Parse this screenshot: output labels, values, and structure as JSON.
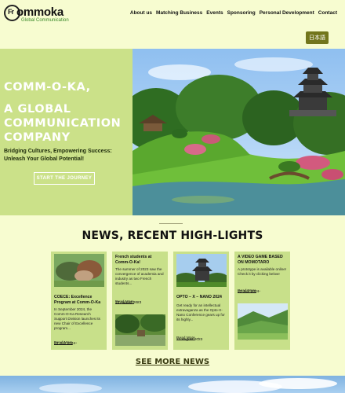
{
  "brand": {
    "logo_mark": "Fr",
    "name": "ommoka",
    "tagline": "Global Communication"
  },
  "nav": {
    "items": [
      {
        "label": "About us"
      },
      {
        "label": "Matching Business"
      },
      {
        "label": "Events"
      },
      {
        "label": "Sponsoring"
      },
      {
        "label": "Personal Development"
      },
      {
        "label": "Contact"
      }
    ]
  },
  "lang_button": "日本語",
  "hero": {
    "title_line1": "COMM-O-KA,",
    "title_line2": "A GLOBAL COMMUNICATION COMPANY",
    "subtitle": "Bridging Cultures, Empowering Success: Unleash Your Global Potential!",
    "cta": "START THE JOURNEY"
  },
  "news": {
    "heading": "NEWS, RECENT HIGH-LIGHTS",
    "cards": [
      {
        "title": "COECE: Excellence Program at Comm-O-Ka",
        "text": "In September 2024, the Comm-O-Ka Research Support Division launches its new Chair of Excellence program...",
        "read_more": "Read More",
        "date": "23 July 2024"
      },
      {
        "title": "French students at Comm-O-Ka!",
        "text": "The summer of 2023 saw the convergence of academia and industry as two French students...",
        "read_more": "Read More",
        "date": "13 August 2023"
      },
      {
        "title": "OPTO – X – NANO 2024",
        "text": "Get ready for an intellectual extravaganza as the Opto-X-Nano Conference gears up for its highly...",
        "read_more": "Read More",
        "date": "12 August 2023"
      },
      {
        "title": "A VIDEO GAME BASED ON MOMOTARO",
        "text": "A prototype is available online! Check it by clicking below!",
        "read_more": "Read More",
        "date": "23 July 2024"
      }
    ],
    "see_more": "SEE MORE NEWS"
  },
  "colors": {
    "page_bg": "#f7fcd0",
    "hero_panel": "#cbe189",
    "card_bg": "#c8e08a",
    "lang_button": "#72761c"
  }
}
